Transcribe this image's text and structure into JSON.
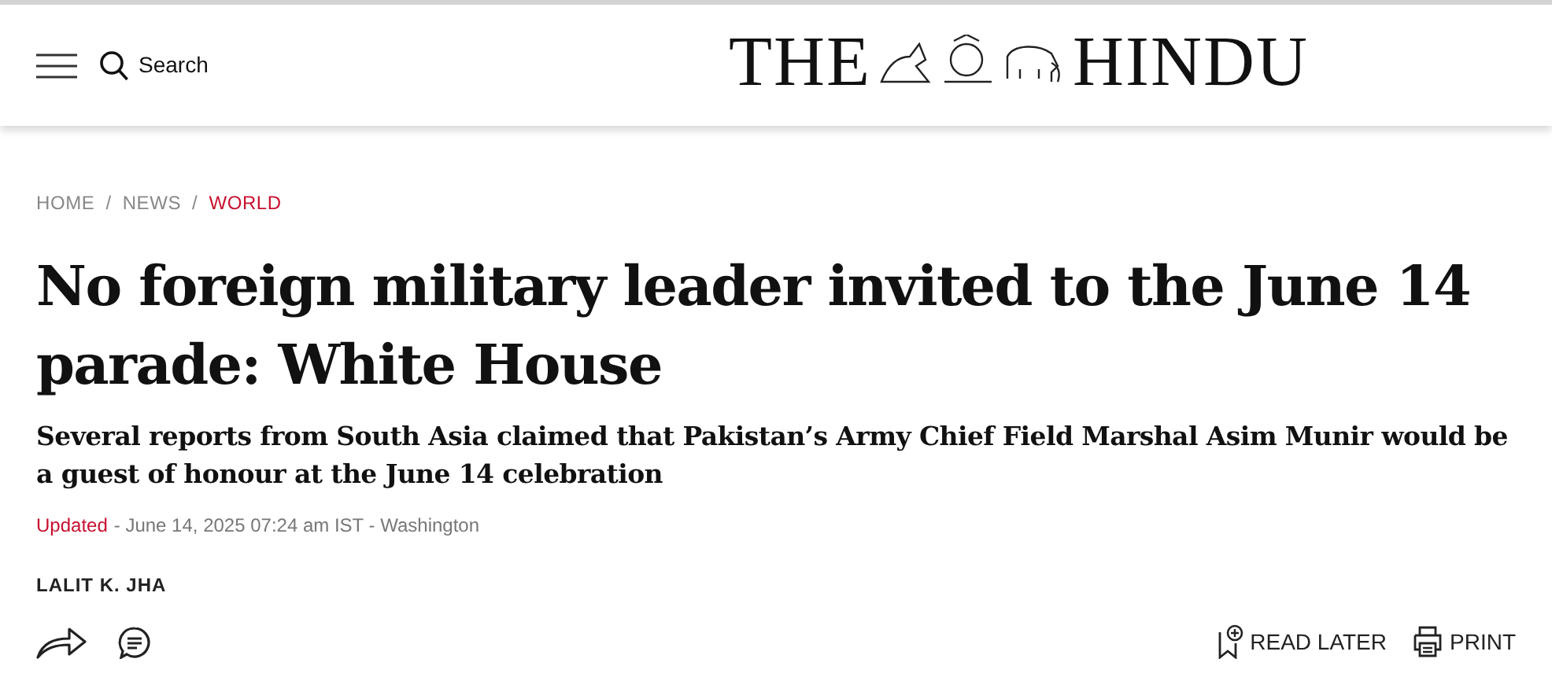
{
  "header": {
    "search_label": "Search",
    "logo": {
      "left": "THE",
      "right": "HINDU"
    }
  },
  "breadcrumb": [
    {
      "label": "HOME",
      "selected": false
    },
    {
      "label": "NEWS",
      "selected": false
    },
    {
      "label": "WORLD",
      "selected": true
    }
  ],
  "separators": [
    "/",
    "/"
  ],
  "headline": "No foreign military leader invited to the June 14 parade: White House",
  "summary": "Several reports from South Asia claimed that Pakistan’s Army Chief Field Marshal Asim Munir would be a guest of honour at the June 14 celebration",
  "dateline": {
    "status": "Updated",
    "text": "- June 14, 2025 07:24 am IST - Washington"
  },
  "author": "LALIT K. JHA",
  "actions": [
    {
      "label": "READ LATER",
      "kind": "bookmark"
    },
    {
      "label": "PRINT",
      "kind": "print"
    }
  ]
}
